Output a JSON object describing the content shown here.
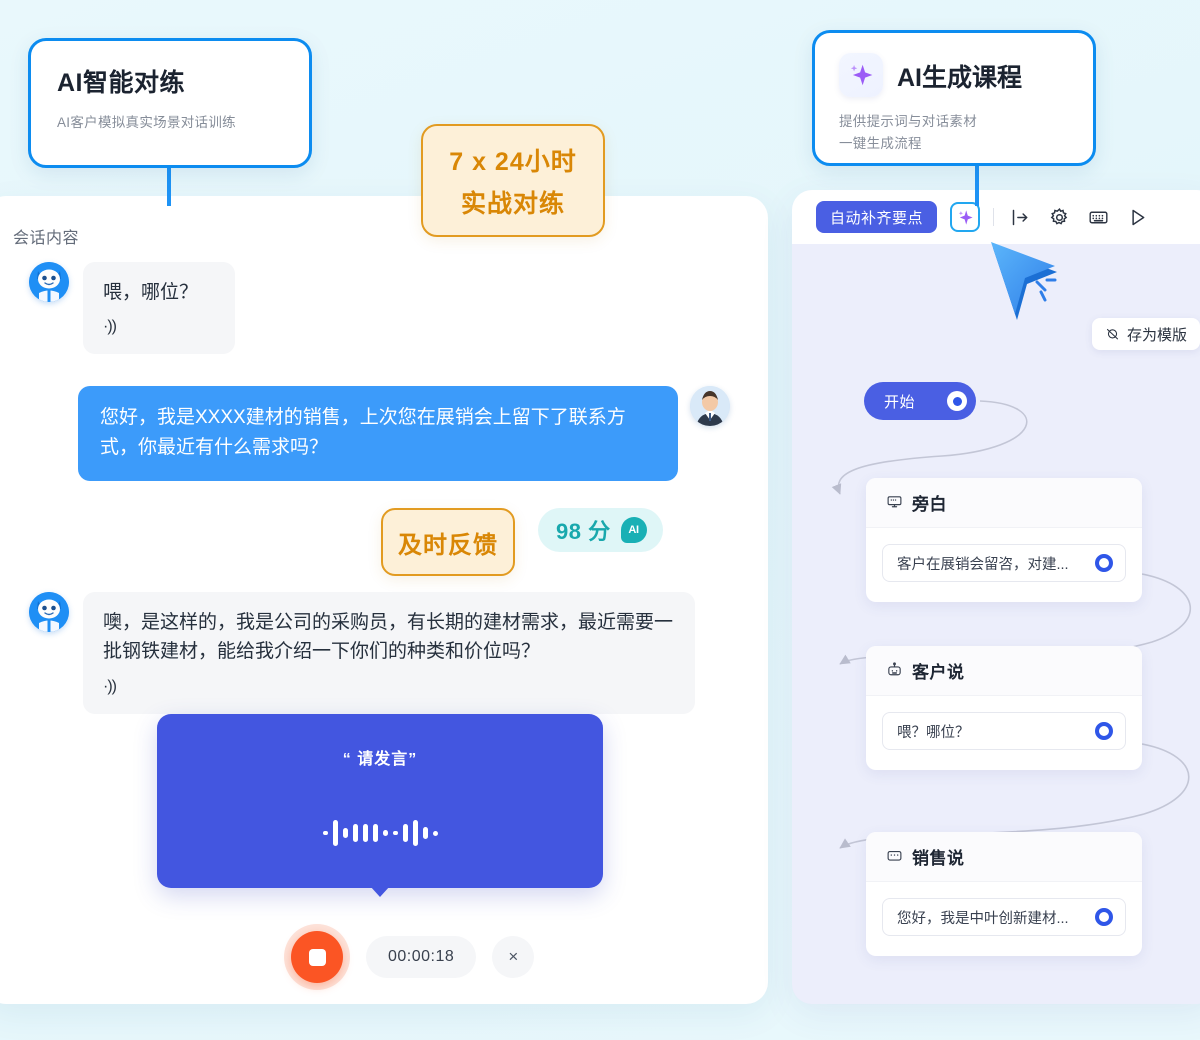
{
  "colors": {
    "page_bg": "#e9f8fc",
    "accent_blue": "#0c8cf0",
    "chat_blue": "#3c9bfa",
    "indigo": "#4a5fe3",
    "record_purple": "#4356e0",
    "orange": "#d98706",
    "badge_bg": "#fdf0d8",
    "teal": "#19a8ad",
    "record_red": "#fb5524",
    "canvas_lavender": "#eceefb"
  },
  "callout_left": {
    "title": "AI智能对练",
    "subtitle": "AI客户模拟真实场景对话训练"
  },
  "callout_right": {
    "icon": "sparkle-icon",
    "title": "AI生成课程",
    "subtitle_line1": "提供提示词与对话素材",
    "subtitle_line2": "一键生成流程"
  },
  "badge_247": {
    "line1": "7 x 24小时",
    "line2": "实战对练"
  },
  "left_panel": {
    "title": "会话内容",
    "messages": [
      {
        "role": "customer",
        "avatar": "bot-avatar",
        "text": "喂，哪位？",
        "audio_icon": "·))"
      },
      {
        "role": "sales",
        "avatar": "salesman-avatar",
        "text": "您好，我是XXXX建材的销售，上次您在展销会上留下了联系方式，你最近有什么需求吗？"
      },
      {
        "role": "customer",
        "avatar": "bot-avatar",
        "text": "噢，是这样的，我是公司的采购员，有长期的建材需求，最近需要一批钢铁建材，能给我介绍一下你们的种类和价位吗？",
        "audio_icon": "·))"
      }
    ],
    "feedback_badge": "及时反馈",
    "score": {
      "value": "98 分",
      "ai_label": "AI"
    },
    "recorder": {
      "prompt": "“ 请发言”",
      "wave_bars": [
        4,
        26,
        10,
        18,
        18,
        18,
        6,
        4,
        18,
        26,
        12,
        5
      ],
      "stop_button_label": "stop-record-button",
      "timer": "00:00:18",
      "close_label": "×"
    }
  },
  "right_panel": {
    "toolbar": {
      "auto_fill_label": "自动补齐要点",
      "sparkle_button": "sparkle-icon",
      "icons": [
        "login-arrow-icon",
        "gear-icon",
        "keyboard-icon",
        "play-icon"
      ]
    },
    "save_template_label": "存为模版",
    "save_template_icon": "template-icon",
    "start_node": {
      "label": "开始"
    },
    "nodes": [
      {
        "icon": "narration-icon",
        "title": "旁白",
        "field_value": "客户在展销会留咨，对建..."
      },
      {
        "icon": "robot-icon",
        "title": "客户说",
        "field_value": "喂？哪位？"
      },
      {
        "icon": "chat-icon",
        "title": "销售说",
        "field_value": "您好，我是中叶创新建材..."
      }
    ],
    "cursor": "mouse-pointer-cursor"
  }
}
